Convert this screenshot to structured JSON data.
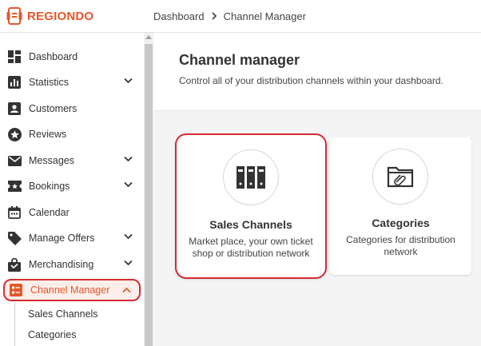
{
  "brand": {
    "name": "REGIONDO",
    "accent": "#e8562a",
    "highlight": "#d62b33"
  },
  "breadcrumb": {
    "home": "Dashboard",
    "current": "Channel Manager"
  },
  "sidebar": {
    "items": [
      {
        "label": "Dashboard",
        "icon": "dashboard-icon",
        "expandable": false
      },
      {
        "label": "Statistics",
        "icon": "bar-chart-icon",
        "expandable": true
      },
      {
        "label": "Customers",
        "icon": "person-icon",
        "expandable": false
      },
      {
        "label": "Reviews",
        "icon": "star-icon",
        "expandable": false
      },
      {
        "label": "Messages",
        "icon": "envelope-icon",
        "expandable": true
      },
      {
        "label": "Bookings",
        "icon": "ticket-icon",
        "expandable": true
      },
      {
        "label": "Calendar",
        "icon": "calendar-icon",
        "expandable": false
      },
      {
        "label": "Manage Offers",
        "icon": "tag-icon",
        "expandable": true
      },
      {
        "label": "Merchandising",
        "icon": "shopping-bag-icon",
        "expandable": true
      },
      {
        "label": "Channel Manager",
        "icon": "channel-icon",
        "expandable": true,
        "active": true
      }
    ],
    "sub_items": [
      "Sales Channels",
      "Categories"
    ]
  },
  "main": {
    "title": "Channel manager",
    "subtitle": "Control all of your distribution channels within your dashboard.",
    "cards": [
      {
        "title": "Sales Channels",
        "desc_line1": "Market place, your own ticket",
        "desc_line2": "shop or distribution network",
        "icon": "binders-icon"
      },
      {
        "title": "Categories",
        "desc_line1": "Categories for distribution",
        "desc_line2": "network",
        "icon": "folder-icon"
      }
    ]
  }
}
